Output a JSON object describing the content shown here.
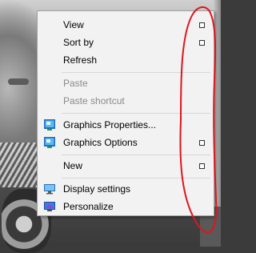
{
  "menu": {
    "items": [
      {
        "label": "View",
        "has_submenu": true,
        "enabled": true
      },
      {
        "label": "Sort by",
        "has_submenu": true,
        "enabled": true
      },
      {
        "label": "Refresh",
        "has_submenu": false,
        "enabled": true
      },
      {
        "label": "Paste",
        "has_submenu": false,
        "enabled": false
      },
      {
        "label": "Paste shortcut",
        "has_submenu": false,
        "enabled": false
      },
      {
        "label": "Graphics Properties...",
        "has_submenu": false,
        "enabled": true,
        "icon": "intel-graphics-icon"
      },
      {
        "label": "Graphics Options",
        "has_submenu": true,
        "enabled": true,
        "icon": "intel-graphics-icon"
      },
      {
        "label": "New",
        "has_submenu": true,
        "enabled": true
      },
      {
        "label": "Display settings",
        "has_submenu": false,
        "enabled": true,
        "icon": "display-monitor-icon"
      },
      {
        "label": "Personalize",
        "has_submenu": false,
        "enabled": true,
        "icon": "personalize-icon"
      }
    ]
  },
  "colors": {
    "menu_background": "#f2f2f2",
    "disabled_text": "#8a8a8a",
    "annotation_red": "#e0141e"
  }
}
